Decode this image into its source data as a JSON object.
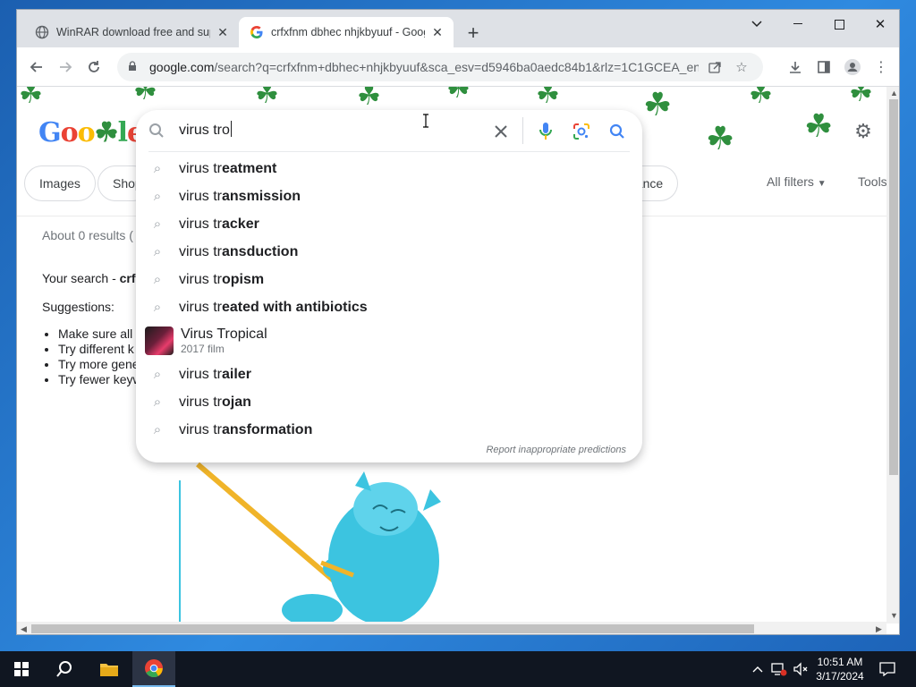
{
  "browser": {
    "tabs": [
      {
        "title": "WinRAR download free and supp",
        "favicon": "globe-icon",
        "active": false
      },
      {
        "title": "crfxfnm dbhec nhjkbyuuf - Goog",
        "favicon": "google-icon",
        "active": true
      }
    ],
    "url_host": "google.com",
    "url_rest": "/search?q=crfxfnm+dbhec+nhjkbyuuf&sca_esv=d5946ba0aedc84b1&rlz=1C1GCEA_enU..."
  },
  "page": {
    "logo_text": "Google",
    "chips": [
      "Images",
      "Shop",
      "nance"
    ],
    "all_filters": "All filters",
    "tools": "Tools",
    "results_meta": "About 0 results (",
    "your_search": "Your search - crf",
    "suggestions_heading": "Suggestions:",
    "suggestions": [
      "Make sure all",
      "Try different k",
      "Try more gene",
      "Try fewer keyw"
    ]
  },
  "searchbox": {
    "query": "virus tro",
    "items": [
      {
        "prefix": "virus tr",
        "bold": "eatment"
      },
      {
        "prefix": "virus tr",
        "bold": "ansmission"
      },
      {
        "prefix": "virus tr",
        "bold": "acker"
      },
      {
        "prefix": "virus tr",
        "bold": "ansduction"
      },
      {
        "prefix": "virus tr",
        "bold": "opism"
      },
      {
        "prefix": "virus tr",
        "bold": "eated with antibiotics"
      }
    ],
    "entity": {
      "title": "Virus Tropical",
      "subtitle": "2017 film"
    },
    "items_after": [
      {
        "prefix": "virus tr",
        "bold": "ailer"
      },
      {
        "prefix": "virus tr",
        "bold": "ojan"
      },
      {
        "prefix": "virus tr",
        "bold": "ansformation"
      }
    ],
    "report": "Report inappropriate predictions"
  },
  "taskbar": {
    "time": "10:51 AM",
    "date": "3/17/2024"
  },
  "colors": {
    "google_blue": "#4285f4",
    "clover_green": "#2f8f3e",
    "mascot_blue": "#3cc4e0"
  }
}
